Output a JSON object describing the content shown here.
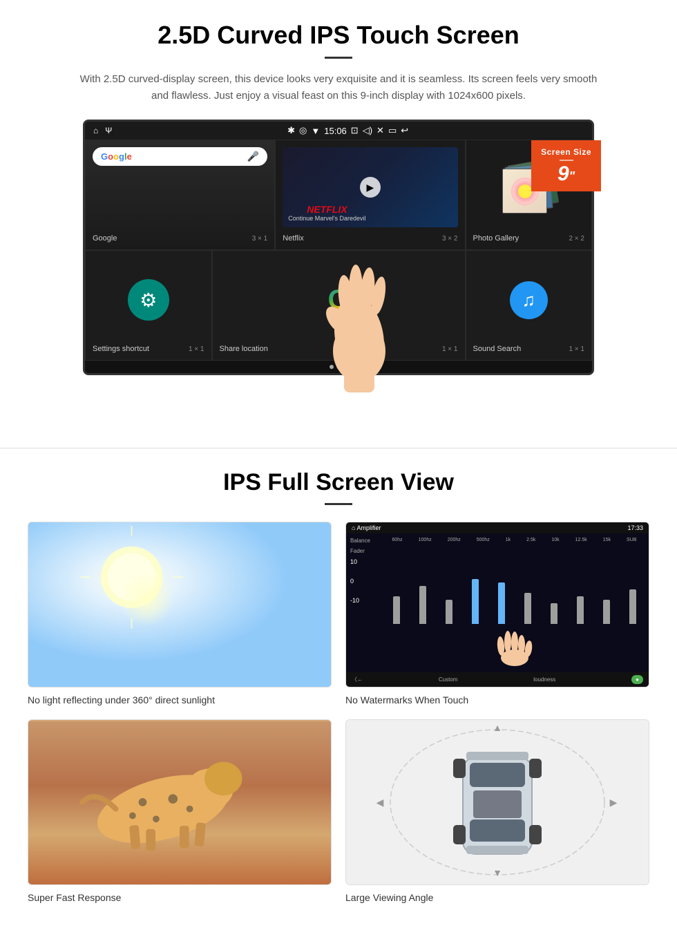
{
  "section1": {
    "title": "2.5D Curved IPS Touch Screen",
    "description": "With 2.5D curved-display screen, this device looks very exquisite and it is seamless. Its screen feels very smooth and flawless. Just enjoy a visual feast on this 9-inch display with 1024x600 pixels.",
    "badge": {
      "label": "Screen Size",
      "size": "9",
      "unit": "\"",
      "color": "#E64A19"
    },
    "statusBar": {
      "time": "15:06"
    },
    "apps": [
      {
        "name": "Google",
        "size": "3 × 1"
      },
      {
        "name": "Netflix",
        "size": "3 × 2"
      },
      {
        "name": "Photo Gallery",
        "size": "2 × 2"
      },
      {
        "name": "Settings shortcut",
        "size": "1 × 1"
      },
      {
        "name": "Share location",
        "size": "1 × 1"
      },
      {
        "name": "Sound Search",
        "size": "1 × 1"
      }
    ],
    "netflix": {
      "logo": "NETFLIX",
      "subtitle": "Continue Marvel's Daredevil"
    }
  },
  "section2": {
    "title": "IPS Full Screen View",
    "features": [
      {
        "id": "sunlight",
        "caption": "No light reflecting under 360° direct sunlight"
      },
      {
        "id": "equalizer",
        "caption": "No Watermarks When Touch"
      },
      {
        "id": "cheetah",
        "caption": "Super Fast Response"
      },
      {
        "id": "car",
        "caption": "Large Viewing Angle"
      }
    ],
    "equalizer": {
      "title": "Amplifier",
      "time": "17:33",
      "labels": [
        "60hz",
        "100hz",
        "200hz",
        "500hz",
        "1k",
        "2.5k",
        "10k",
        "12.5k",
        "15k",
        "SUB"
      ],
      "heights": [
        50,
        60,
        45,
        70,
        65,
        55,
        40,
        50,
        45,
        60
      ],
      "sidebarLabels": [
        "10",
        "0",
        "-10"
      ],
      "mode": "Custom",
      "loudness": "loudness"
    }
  }
}
